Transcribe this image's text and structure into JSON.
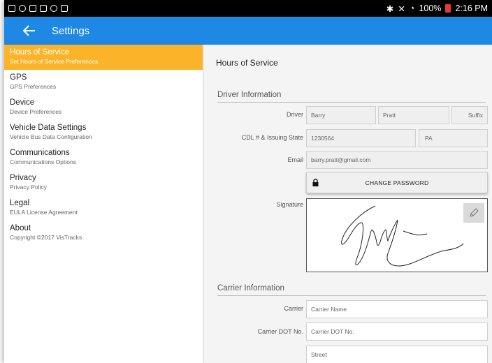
{
  "status_bar": {
    "time": "2:16 PM",
    "battery_percent": "100%"
  },
  "app_bar": {
    "title": "Settings"
  },
  "sidebar": {
    "items": [
      {
        "title": "Hours of Service",
        "subtitle": "Set Hours of Service Preferences"
      },
      {
        "title": "GPS",
        "subtitle": "GPS Preferences"
      },
      {
        "title": "Device",
        "subtitle": "Device Preferences"
      },
      {
        "title": "Vehicle Data Settings",
        "subtitle": "Vehicle Bus Data Configuration"
      },
      {
        "title": "Communications",
        "subtitle": "Communications Options"
      },
      {
        "title": "Privacy",
        "subtitle": "Privacy Policy"
      },
      {
        "title": "Legal",
        "subtitle": "EULA License Agreement"
      },
      {
        "title": "About",
        "subtitle": "Copyright ©2017 VisTracks"
      }
    ]
  },
  "main": {
    "title": "Hours of Service",
    "driver_section": {
      "title": "Driver Information",
      "driver_label": "Driver",
      "first_name": "Barry",
      "last_name": "Pratt",
      "suffix_placeholder": "Suffix",
      "cdl_label": "CDL # & Issuing State",
      "cdl_number": "1230564",
      "cdl_state": "PA",
      "email_label": "Email",
      "email": "barry.pratt@gmail.com",
      "change_password": "CHANGE PASSWORD",
      "signature_label": "Signature"
    },
    "carrier_section": {
      "title": "Carrier Information",
      "carrier_label": "Carrier",
      "carrier_placeholder": "Carrier Name",
      "dot_label": "Carrier DOT No.",
      "dot_placeholder": "Carrier DOT No.",
      "street_placeholder": "Street"
    }
  },
  "colors": {
    "app_bar": "#1e88e5",
    "active_item": "#fbb42a",
    "status_bar": "#000000",
    "battery": "#e53935"
  }
}
